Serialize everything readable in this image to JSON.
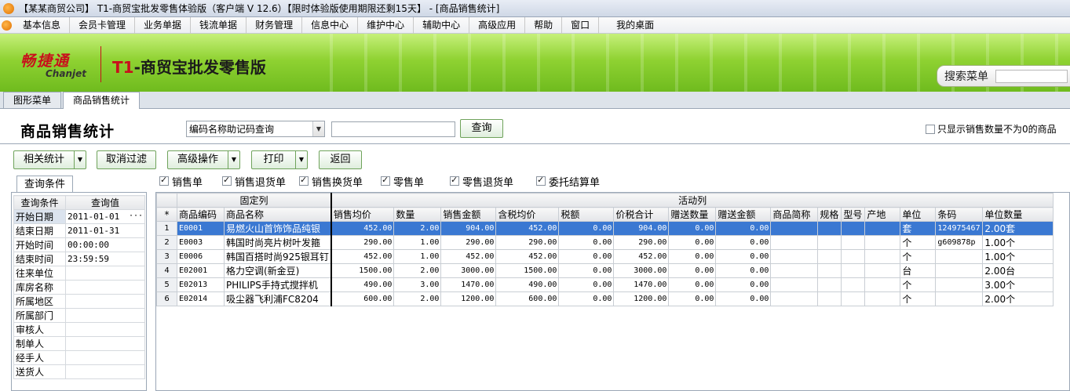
{
  "window": {
    "title": "【某某商贸公司】 T1-商贸宝批发零售体验版（客户端 V 12.6）【限时体验版使用期限还剩15天】 - [商品销售统计]"
  },
  "menu": [
    "基本信息",
    "会员卡管理",
    "业务单据",
    "钱流单据",
    "财务管理",
    "信息中心",
    "维护中心",
    "辅助中心",
    "高级应用",
    "帮助",
    "窗口",
    "我的桌面"
  ],
  "banner": {
    "brand_cn": "畅捷通",
    "brand_en": "Chanjet",
    "product_prefix": "T1",
    "product_name": "-商贸宝批发零售版",
    "search_label": "搜索菜单"
  },
  "tabs": [
    "图形菜单",
    "商品销售统计"
  ],
  "page": {
    "title": "商品销售统计",
    "query_mode": "编码名称助记码查询",
    "query_button": "查询",
    "only_nonzero_label": "只显示销售数量不为0的商品"
  },
  "toolbar": {
    "related_stats": "相关统计",
    "clear_filter": "取消过滤",
    "advanced": "高级操作",
    "print": "打印",
    "back": "返回"
  },
  "doc_types": [
    {
      "label": "销售单",
      "checked": true
    },
    {
      "label": "销售退货单",
      "checked": true
    },
    {
      "label": "销售换货单",
      "checked": true
    },
    {
      "label": "零售单",
      "checked": true
    },
    {
      "label": "零售退货单",
      "checked": true
    },
    {
      "label": "委托结算单",
      "checked": true
    }
  ],
  "query_panel": {
    "tab": "查询条件",
    "col_condition": "查询条件",
    "col_value": "查询值",
    "rows": [
      {
        "k": "开始日期",
        "v": "2011-01-01"
      },
      {
        "k": "结束日期",
        "v": "2011-01-31"
      },
      {
        "k": "开始时间",
        "v": "00:00:00"
      },
      {
        "k": "结束时间",
        "v": "23:59:59"
      },
      {
        "k": "往来单位",
        "v": ""
      },
      {
        "k": "库房名称",
        "v": ""
      },
      {
        "k": "所属地区",
        "v": ""
      },
      {
        "k": "所属部门",
        "v": ""
      },
      {
        "k": "审核人",
        "v": ""
      },
      {
        "k": "制单人",
        "v": ""
      },
      {
        "k": "经手人",
        "v": ""
      },
      {
        "k": "送货人",
        "v": ""
      }
    ]
  },
  "grid": {
    "group_fixed": "固定列",
    "group_active": "活动列",
    "star": "*",
    "columns": [
      "商品编码",
      "商品名称",
      "销售均价",
      "数量",
      "销售金额",
      "含税均价",
      "税额",
      "价税合计",
      "赠送数量",
      "赠送金额",
      "商品简称",
      "规格",
      "型号",
      "产地",
      "单位",
      "条码",
      "单位数量"
    ],
    "rows": [
      [
        "1",
        "E0001",
        "易燃火山首饰饰品纯银",
        "452.00",
        "2.00",
        "904.00",
        "452.00",
        "0.00",
        "904.00",
        "0.00",
        "0.00",
        "",
        "",
        "",
        "",
        "套",
        "124975467",
        "2.00套"
      ],
      [
        "2",
        "E0003",
        "韩国时尚亮片树叶发箍",
        "290.00",
        "1.00",
        "290.00",
        "290.00",
        "0.00",
        "290.00",
        "0.00",
        "0.00",
        "",
        "",
        "",
        "",
        "个",
        "g609878p",
        "1.00个"
      ],
      [
        "3",
        "E0006",
        "韩国百搭时尚925银耳钉",
        "452.00",
        "1.00",
        "452.00",
        "452.00",
        "0.00",
        "452.00",
        "0.00",
        "0.00",
        "",
        "",
        "",
        "",
        "个",
        "",
        "1.00个"
      ],
      [
        "4",
        "E02001",
        "格力空调(新金豆)",
        "1500.00",
        "2.00",
        "3000.00",
        "1500.00",
        "0.00",
        "3000.00",
        "0.00",
        "0.00",
        "",
        "",
        "",
        "",
        "台",
        "",
        "2.00台"
      ],
      [
        "5",
        "E02013",
        "PHILIPS手持式搅拌机",
        "490.00",
        "3.00",
        "1470.00",
        "490.00",
        "0.00",
        "1470.00",
        "0.00",
        "0.00",
        "",
        "",
        "",
        "",
        "个",
        "",
        "3.00个"
      ],
      [
        "6",
        "E02014",
        "吸尘器飞利浦FC8204",
        "600.00",
        "2.00",
        "1200.00",
        "600.00",
        "0.00",
        "1200.00",
        "0.00",
        "0.00",
        "",
        "",
        "",
        "",
        "个",
        "",
        "2.00个"
      ]
    ]
  }
}
